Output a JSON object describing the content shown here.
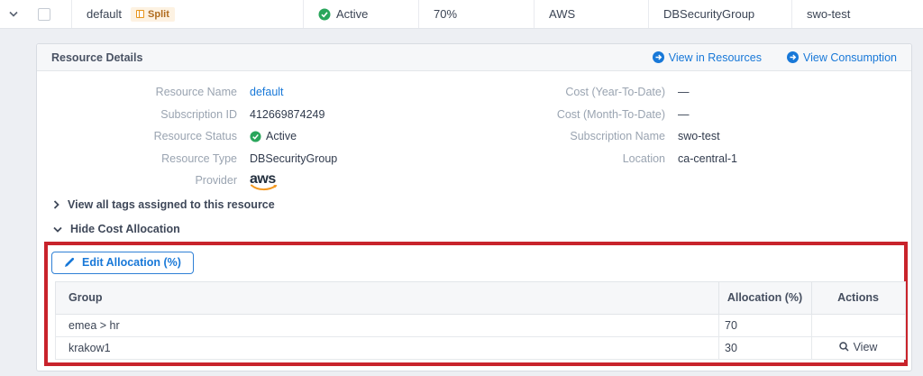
{
  "top_row": {
    "name": "default",
    "split_badge": "Split",
    "status": "Active",
    "allocation_pct": "70%",
    "provider": "AWS",
    "resource_type": "DBSecurityGroup",
    "subscription": "swo-test"
  },
  "panel": {
    "title": "Resource Details",
    "links": [
      {
        "label": "View in Resources"
      },
      {
        "label": "View Consumption"
      }
    ],
    "fields_left": [
      {
        "label": "Resource Name",
        "value": "default"
      },
      {
        "label": "Subscription ID",
        "value": "412669874249"
      },
      {
        "label": "Resource Status",
        "value": "Active"
      },
      {
        "label": "Resource Type",
        "value": "DBSecurityGroup"
      },
      {
        "label": "Provider",
        "value": "aws"
      }
    ],
    "fields_right": [
      {
        "label": "Cost (Year-To-Date)",
        "value": "—"
      },
      {
        "label": "Cost (Month-To-Date)",
        "value": "—"
      },
      {
        "label": "Subscription Name",
        "value": "swo-test"
      },
      {
        "label": "Location",
        "value": "ca-central-1"
      }
    ],
    "toggles": {
      "tags": "View all tags assigned to this resource",
      "cost_allocation": "Hide Cost Allocation"
    },
    "allocation_section": {
      "edit_button": "Edit Allocation (%)",
      "table": {
        "headers": [
          "Group",
          "Allocation (%)",
          "Actions"
        ],
        "rows": [
          {
            "group": "emea > hr",
            "allocation": "70",
            "action": ""
          },
          {
            "group": "krakow1",
            "allocation": "30",
            "action": "View"
          }
        ]
      }
    }
  },
  "icons": {
    "chevron_down": "expand-collapse chevron",
    "chevron_right": "collapsed chevron",
    "check_circle": "green status check",
    "arrow_circle": "blue circled arrow",
    "pencil": "edit pencil",
    "magnifier": "search / view",
    "split": "split allocation badge icon",
    "aws_smile": "aws logo smile arrow"
  },
  "colors": {
    "link_blue": "#1878d8",
    "status_green": "#2aa65c",
    "highlight_red": "#c8232b",
    "badge_orange_bg": "#fdf2e2",
    "badge_orange_text": "#b06c1f",
    "aws_orange": "#f4981f"
  }
}
